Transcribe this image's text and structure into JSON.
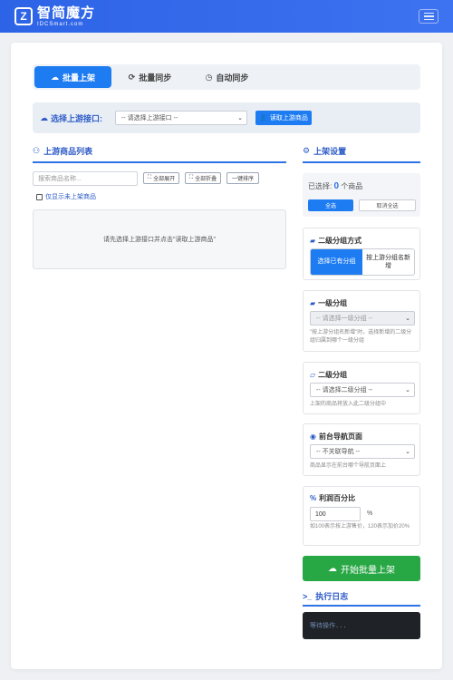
{
  "brand": {
    "title": "智简魔方",
    "subtitle": "IDCSmart.com",
    "mark": "Z"
  },
  "tabs": [
    {
      "label": "批量上架",
      "icon": "cloud-upload-icon"
    },
    {
      "label": "批量同步",
      "icon": "sync-icon"
    },
    {
      "label": "自动同步",
      "icon": "clock-icon"
    }
  ],
  "upstream": {
    "label": "选择上游接口:",
    "select_value": "-- 请选择上游接口 --",
    "fetch_button": "读取上游商品"
  },
  "product_list": {
    "title": "上游商品列表",
    "search_placeholder": "搜索商品名称...",
    "expand_all": "全部展开",
    "collapse_all": "全部折叠",
    "sort": "一键排序",
    "only_unlisted": "仅显示未上架商品",
    "empty_text": "请先选择上游接口并点击\"读取上游商品\""
  },
  "settings": {
    "title": "上架设置",
    "selected_prefix": "已选择:",
    "selected_count": "0",
    "selected_suffix": "个商品",
    "select_all": "全选",
    "unselect_all": "取消全选",
    "group_mode": {
      "title": "二级分组方式",
      "option_existing": "选择已有分组",
      "option_upstream": "按上游分组名新增"
    },
    "level1": {
      "title": "一级分组",
      "select_value": "-- 请选择一级分组 --",
      "hint": "\"按上游分组名新增\"时，选择新增的二级分组归属到哪个一级分组"
    },
    "level2": {
      "title": "二级分组",
      "select_value": "-- 请选择二级分组 --",
      "hint": "上架的商品将放入此二级分组中"
    },
    "nav": {
      "title": "前台导航页面",
      "select_value": "-- 不关联导航 --",
      "hint": "商品显示在前台哪个导航页面上"
    },
    "profit": {
      "title": "利润百分比",
      "value": "100",
      "unit": "%",
      "hint": "如100表示按上游售价，120表示加价20%"
    },
    "start_button": "开始批量上架"
  },
  "log": {
    "title": "执行日志",
    "text": "等待操作..."
  },
  "colors": {
    "primary": "#1d7cf2",
    "brand": "#2d63e6",
    "success": "#28a745",
    "title": "#2d5bc7"
  }
}
